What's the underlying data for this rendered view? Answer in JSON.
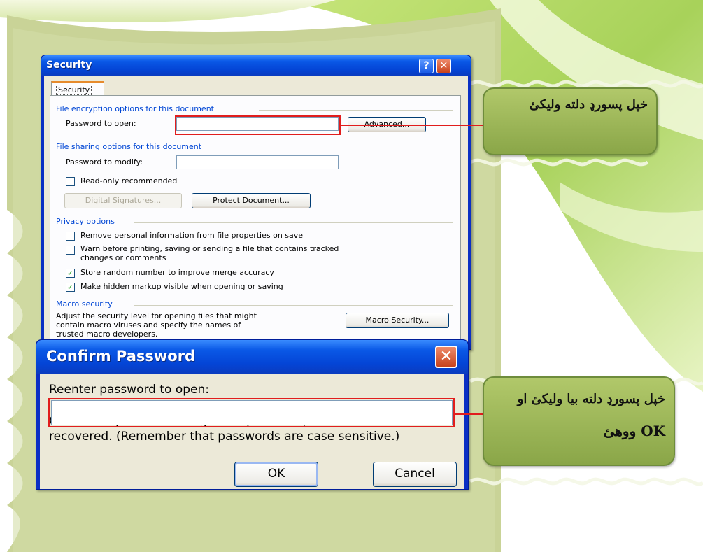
{
  "security_dialog": {
    "title": "Security",
    "help_icon": "?",
    "close_icon": "✕",
    "tab": "Security",
    "encryption": {
      "group_label": "File encryption options for this document",
      "password_label": "Password to open:",
      "advanced_button": "Advanced..."
    },
    "sharing": {
      "group_label": "File sharing options for this document",
      "password_label": "Password to modify:",
      "readonly_label": "Read-only recommended",
      "readonly_checked": false,
      "digital_signatures_button": "Digital Signatures...",
      "protect_document_button": "Protect Document..."
    },
    "privacy": {
      "group_label": "Privacy options",
      "options": [
        {
          "label": "Remove personal information from file properties on save",
          "checked": false
        },
        {
          "label": "Warn before printing, saving or sending a file that contains tracked",
          "label2": "changes or comments",
          "checked": false
        },
        {
          "label": "Store random number to improve merge accuracy",
          "checked": true
        },
        {
          "label": "Make hidden markup visible when opening or saving",
          "checked": true
        }
      ]
    },
    "macro": {
      "group_label": "Macro security",
      "text_line1": "Adjust the security level for opening files that might",
      "text_line2": "contain macro viruses and specify the names of",
      "text_line3": "trusted macro developers.",
      "button": "Macro Security..."
    }
  },
  "confirm_dialog": {
    "title": "Confirm Password",
    "close_icon": "✕",
    "prompt": "Reenter password to open:",
    "caution_line1": "Caution:  If you lose or forget the password, it cannot be",
    "caution_line2": "recovered. (Remember that passwords are case sensitive.)",
    "ok_button": "OK",
    "cancel_button": "Cancel"
  },
  "callouts": {
    "top": "خپل پسورډ دلته ولیکئ",
    "bottom_line1": "خپل پسورډ دلته بیا ولیکئ او",
    "bottom_line2": "OK ووهئ"
  }
}
